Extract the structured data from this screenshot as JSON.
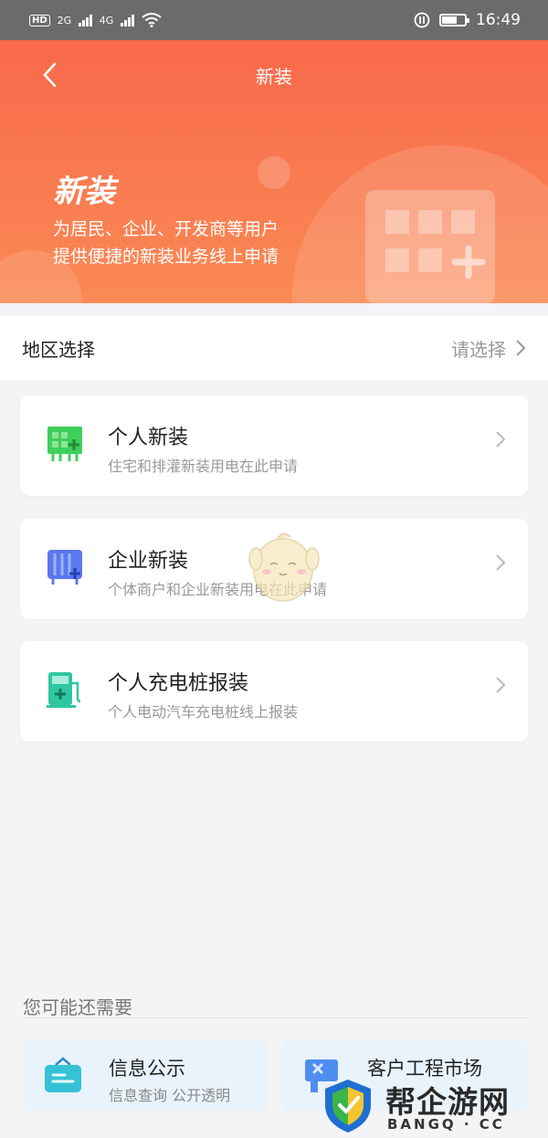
{
  "status_bar": {
    "hd_label": "HD",
    "net1": "2G",
    "net2": "4G",
    "time": "16:49"
  },
  "nav": {
    "title": "新装"
  },
  "hero": {
    "heading": "新装",
    "line1": "为居民、企业、开发商等用户",
    "line2": "提供便捷的新装业务线上申请"
  },
  "region": {
    "label": "地区选择",
    "placeholder": "请选择"
  },
  "services": [
    {
      "title": "个人新装",
      "desc": "住宅和排灌新装用电在此申请",
      "icon": "green-panel-icon",
      "color": "#3fcf5b"
    },
    {
      "title": "企业新装",
      "desc": "个体商户和企业新装用电在此申请",
      "icon": "blue-building-icon",
      "color": "#5a78f0"
    },
    {
      "title": "个人充电桩报装",
      "desc": "个人电动汽车充电桩线上报装",
      "icon": "charging-station-icon",
      "color": "#2fc6a0"
    }
  ],
  "maybe": {
    "label": "您可能还需要",
    "items": [
      {
        "title": "信息公示",
        "desc": "信息查询 公开透明",
        "icon": "notice-board-icon"
      },
      {
        "title": "客户工程市场",
        "desc": "",
        "icon": "tools-market-icon"
      }
    ]
  },
  "watermark": {
    "site_name": "帮企游网",
    "site_sub": "BANGQ · CC"
  },
  "colors": {
    "hero_top": "#f8694b",
    "hero_bottom": "#fa8a55",
    "page_bg": "#f3f4f6"
  }
}
